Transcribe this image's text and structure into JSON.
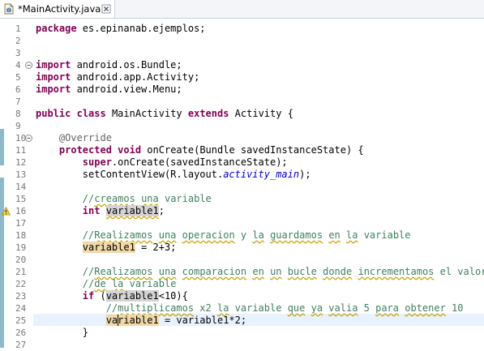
{
  "tab": {
    "title": "*MainActivity.java",
    "icon": "java-file-icon",
    "close_icon": "close-icon"
  },
  "editor": {
    "lines": [
      {
        "n": "1"
      },
      {
        "n": "2"
      },
      {
        "n": "3"
      },
      {
        "n": "4"
      },
      {
        "n": "5"
      },
      {
        "n": "6"
      },
      {
        "n": "7"
      },
      {
        "n": "8"
      },
      {
        "n": "9"
      },
      {
        "n": "10"
      },
      {
        "n": "11"
      },
      {
        "n": "12"
      },
      {
        "n": "13"
      },
      {
        "n": "14"
      },
      {
        "n": "15"
      },
      {
        "n": "16"
      },
      {
        "n": "17"
      },
      {
        "n": "18"
      },
      {
        "n": "19"
      },
      {
        "n": "20"
      },
      {
        "n": "21"
      },
      {
        "n": "22"
      },
      {
        "n": "23"
      },
      {
        "n": "24"
      },
      {
        "n": "25"
      },
      {
        "n": "26"
      },
      {
        "n": "27"
      }
    ],
    "code": {
      "l1_kw": "package",
      "l1_rest": " es.epinanab.ejemplos;",
      "l4_kw": "import",
      "l4_rest": " android.os.Bundle;",
      "l5_kw": "import",
      "l5_rest": " android.app.Activity;",
      "l6_kw": "import",
      "l6_rest": " android.view.Menu;",
      "l8_kw1": "public",
      "l8_kw2": "class",
      "l8_name": " MainActivity ",
      "l8_kw3": "extends",
      "l8_rest": " Activity {",
      "l10_ann": "@Override",
      "l11_kw1": "protected",
      "l11_kw2": "void",
      "l11_rest": " onCreate(Bundle savedInstanceState) {",
      "l12_kw": "super",
      "l12_rest": ".onCreate(savedInstanceState);",
      "l13_pre": "setContentView(R.layout.",
      "l13_it": "activity_main",
      "l13_post": ");",
      "l15_a": "//",
      "l15_b": "creamos",
      "l15_c": " ",
      "l15_d": "una",
      "l15_e": " variable",
      "l16_kw": "int",
      "l16_var": "variable1",
      "l16_post": ";",
      "l18_a": "//",
      "l18_b": "Realizamos",
      "l18_c": " ",
      "l18_d": "una",
      "l18_e": " ",
      "l18_f": "operacion",
      "l18_g": " y ",
      "l18_h": "la",
      "l18_i": " ",
      "l18_j": "guardamos",
      "l18_k": " ",
      "l18_l": "en",
      "l18_m": " ",
      "l18_n": "la",
      "l18_o": " variable",
      "l19_var": "variable1",
      "l19_post": " = 2+3;",
      "l21_a": "//",
      "l21_b": "Realizamos",
      "l21_c": " ",
      "l21_d": "una",
      "l21_e": " ",
      "l21_f": "comparacion",
      "l21_g": " ",
      "l21_h": "en",
      "l21_i": " ",
      "l21_j": "un",
      "l21_k": " ",
      "l21_l": "bucle",
      "l21_m": " ",
      "l21_n": "donde",
      "l21_o": " ",
      "l21_p": "incrementamos",
      "l21_q": " el valor",
      "l22_a": "//",
      "l22_b": "de",
      "l22_c": " ",
      "l22_d": "la",
      "l22_e": " variable",
      "l23_kw": "if",
      "l23_pre": " (",
      "l23_var": "variable1",
      "l23_post": "<10){",
      "l24_a": "//",
      "l24_b": "multiplicamos",
      "l24_c": " x2 ",
      "l24_d": "la",
      "l24_e": " variable ",
      "l24_f": "que",
      "l24_g": " ",
      "l24_h": "ya",
      "l24_i": " ",
      "l24_j": "valia",
      "l24_k": " 5 ",
      "l24_l": "para",
      "l24_m": " ",
      "l24_n": "obtener",
      "l24_o": " 10",
      "l25_var": "variable1",
      "l25_post": " = variable1*2;",
      "l26": "}"
    }
  }
}
